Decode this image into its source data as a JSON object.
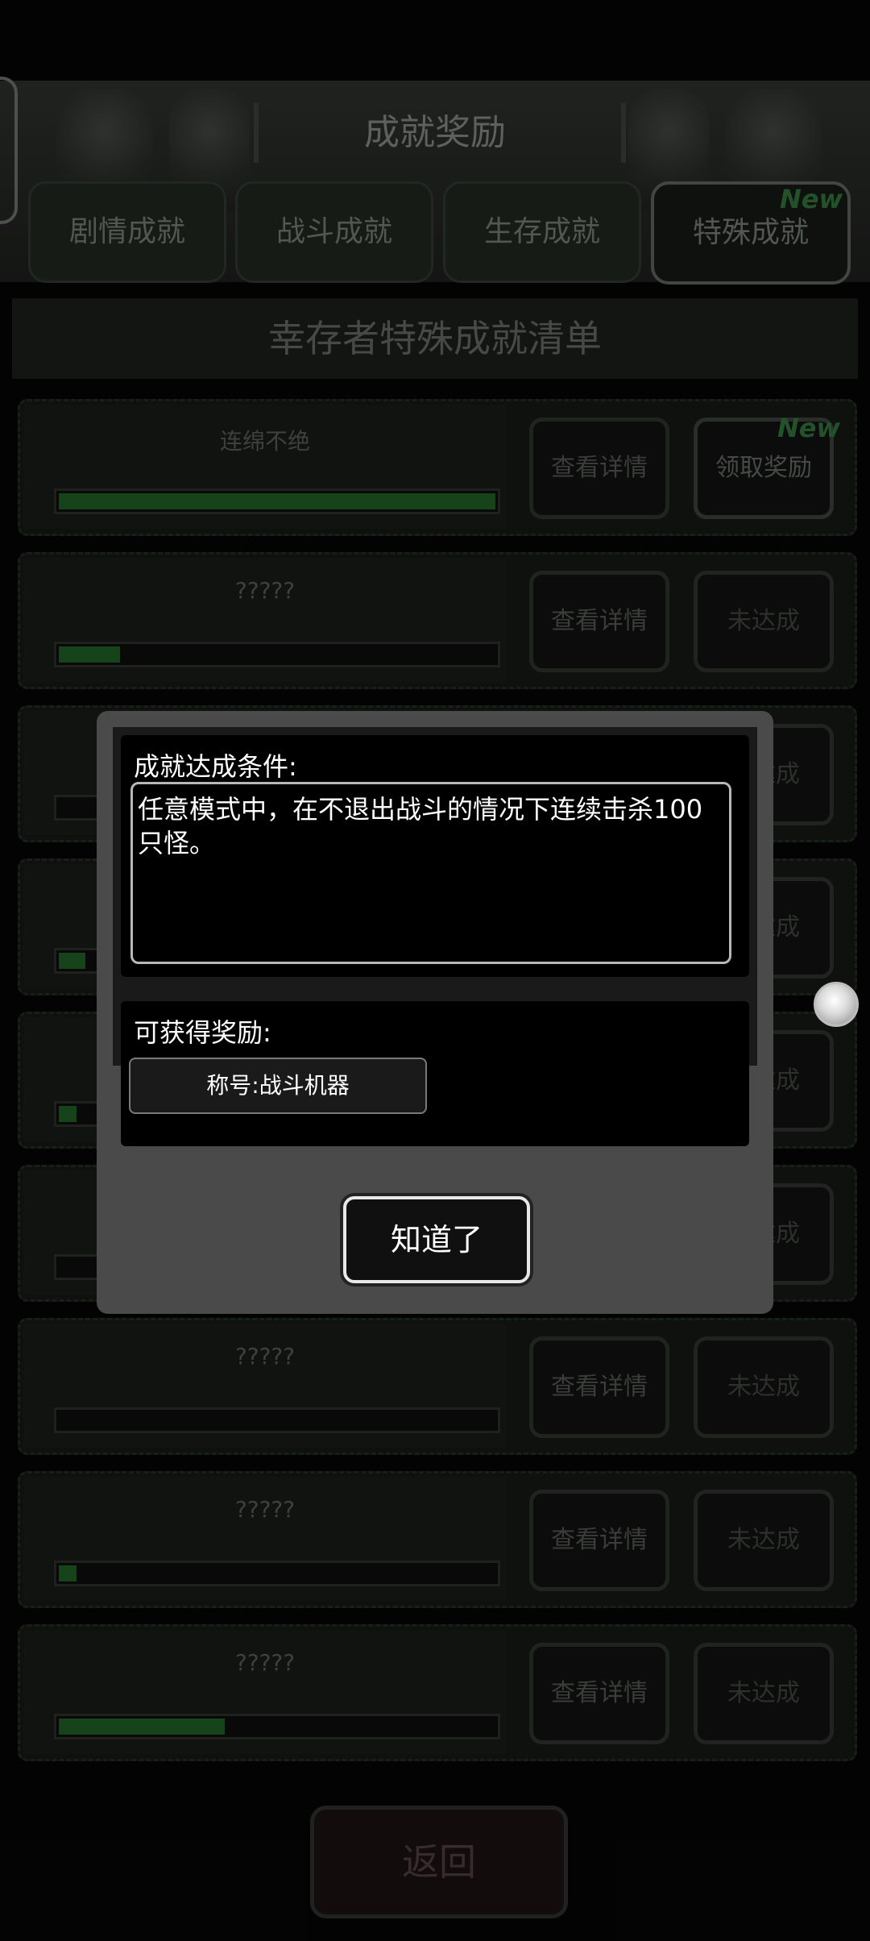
{
  "header": {
    "title": "成就奖励",
    "tabs": [
      {
        "label": "剧情成就"
      },
      {
        "label": "战斗成就"
      },
      {
        "label": "生存成就"
      },
      {
        "label": "特殊成就",
        "badge": "New"
      }
    ]
  },
  "list": {
    "heading": "幸存者特殊成就清单",
    "detail_label": "查看详情",
    "items": [
      {
        "name": "连绵不绝",
        "progress": 1.0,
        "action": "领取奖励",
        "badge": "New"
      },
      {
        "name": "?????",
        "progress": 0.14,
        "action": "未达成"
      },
      {
        "name": "?????",
        "progress": 0.0,
        "action": "未达成"
      },
      {
        "name": "?????",
        "progress": 0.06,
        "action": "未达成"
      },
      {
        "name": "?????",
        "progress": 0.04,
        "action": "未达成"
      },
      {
        "name": "?????",
        "progress": 0.0,
        "action": "未达成"
      },
      {
        "name": "?????",
        "progress": 0.0,
        "action": "未达成"
      },
      {
        "name": "?????",
        "progress": 0.04,
        "action": "未达成"
      },
      {
        "name": "?????",
        "progress": 0.38,
        "action": "未达成"
      }
    ]
  },
  "back_label": "返回",
  "dialog": {
    "condition_label": "成就达成条件:",
    "condition_text": "任意模式中，在不退出战斗的情况下连续击杀100只怪。",
    "reward_label": "可获得奖励:",
    "reward_item": "称号:战斗机器",
    "confirm_label": "知道了"
  },
  "colors": {
    "progress_fill": "#1f5a24",
    "new_badge": "#2f6d37",
    "dialog_bg": "#4a4a4a"
  }
}
